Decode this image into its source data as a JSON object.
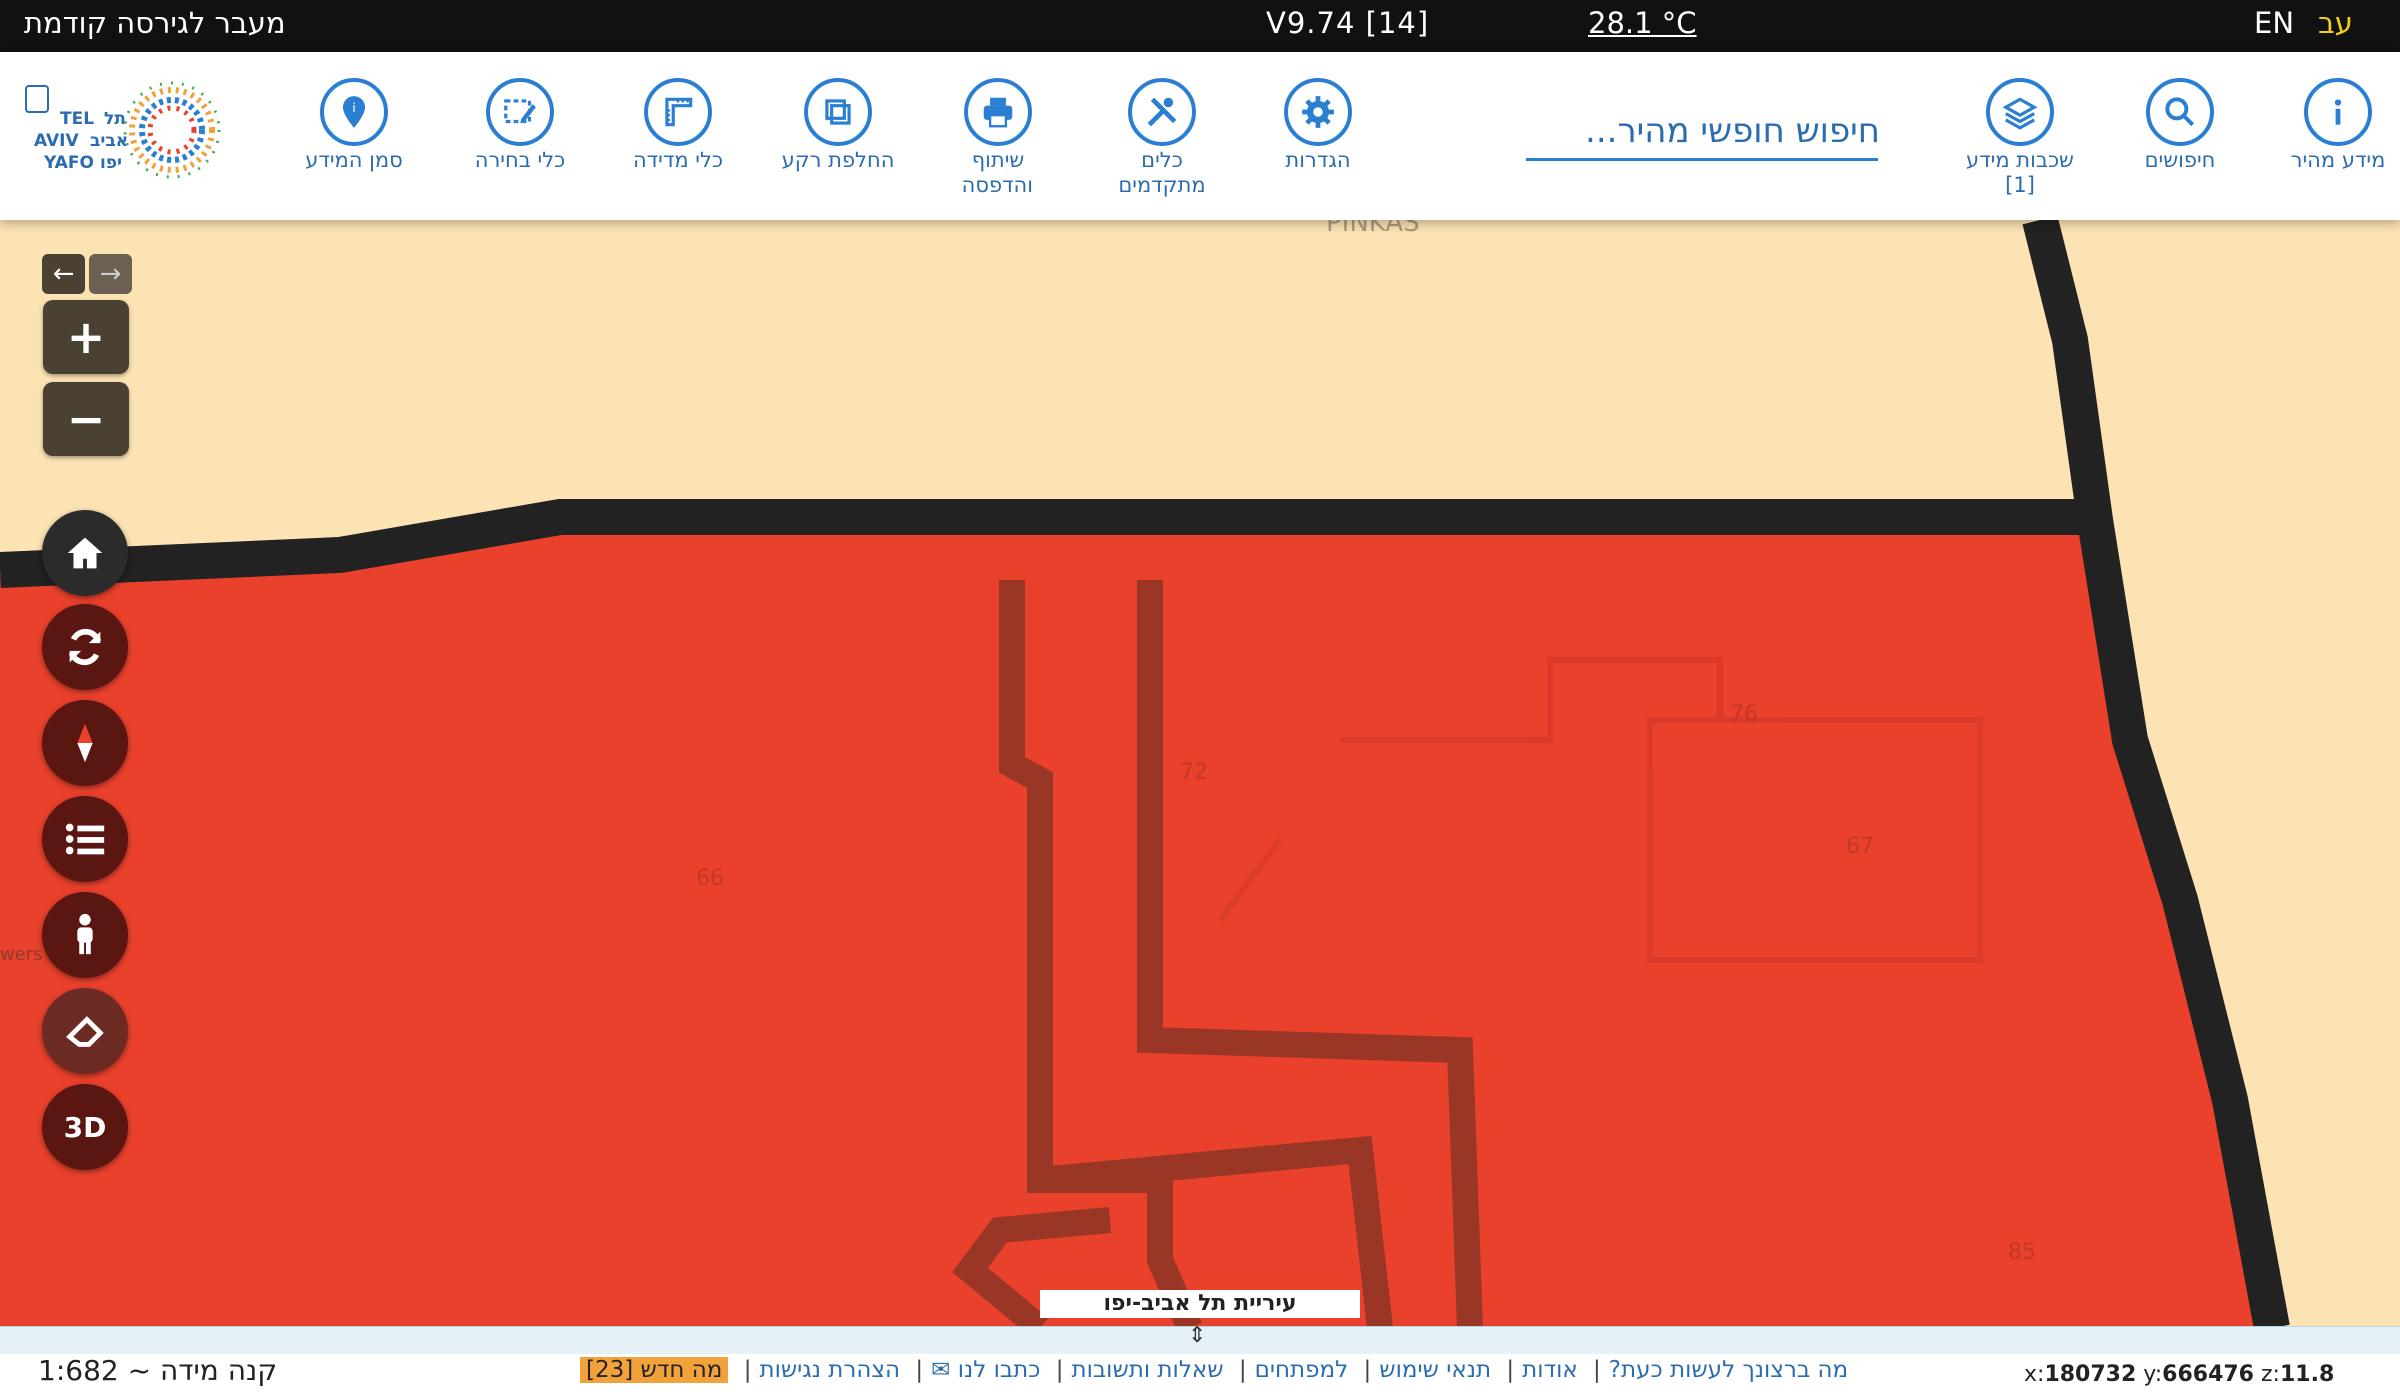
{
  "topbar": {
    "previous_version": "מעבר לגירסה קודמת",
    "version": "V9.74 [14]",
    "temperature": "28.1 °C",
    "lang_en": "EN",
    "lang_he": "עב"
  },
  "toolbar": {
    "tools": [
      {
        "label": "מידע מהיר",
        "icon": "info-icon"
      },
      {
        "label": "חיפושים",
        "icon": "search-icon"
      },
      {
        "label": "שכבות מידע [1]",
        "icon": "layers-icon"
      },
      {
        "label": "הגדרות",
        "icon": "gear-icon"
      },
      {
        "label": "כלים מתקדמים",
        "icon": "tools-icon"
      },
      {
        "label": "שיתוף והדפסה",
        "icon": "printer-icon"
      },
      {
        "label": "החלפת רקע",
        "icon": "basemap-icon"
      },
      {
        "label": "כלי מדידה",
        "icon": "ruler-icon"
      },
      {
        "label": "כלי בחירה",
        "icon": "select-icon"
      },
      {
        "label": "סמן המידע",
        "icon": "pin-icon"
      }
    ],
    "search_placeholder": "חיפוש חופשי מהיר..."
  },
  "logo": {
    "text_en_1": "TEL",
    "text_en_2": "AVIV",
    "text_en_3": "YAFO",
    "text_he_1": "תל",
    "text_he_2": "אביב",
    "text_he_3": "יפו"
  },
  "map": {
    "parcel_labels": [
      "66",
      "72",
      "76",
      "67",
      "85"
    ],
    "street_label": "PINKAS",
    "edge_label": "wers",
    "city_label": "עיריית תל אביב-יפו",
    "colors": {
      "parcel": "#e9412c",
      "background": "#fbe3b4",
      "border": "#222222",
      "inner_line": "#8d3524"
    }
  },
  "controls": {
    "back": "←",
    "forward": "→",
    "zoom_in": "+",
    "zoom_out": "−",
    "three_d": "3D",
    "buttons": [
      "home-icon",
      "refresh-icon",
      "compass-icon",
      "list-icon",
      "streetview-icon",
      "eraser-icon"
    ]
  },
  "bottom": {
    "splitter_glyph": "⇕",
    "scale": "קנה מידה ~ 1:682",
    "links": [
      "מה ברצונך לעשות כעת?",
      "אודות",
      "תנאי שימוש",
      "למפתחים",
      "שאלות ותשובות",
      "כתבו לנו ✉",
      "הצהרת נגישות"
    ],
    "whats_new": "מה חדש [23]",
    "coords": {
      "x_label": "x:",
      "x": "180732",
      "y_label": "y:",
      "y": "666476",
      "z_label": "z:",
      "z": "11.8"
    }
  }
}
